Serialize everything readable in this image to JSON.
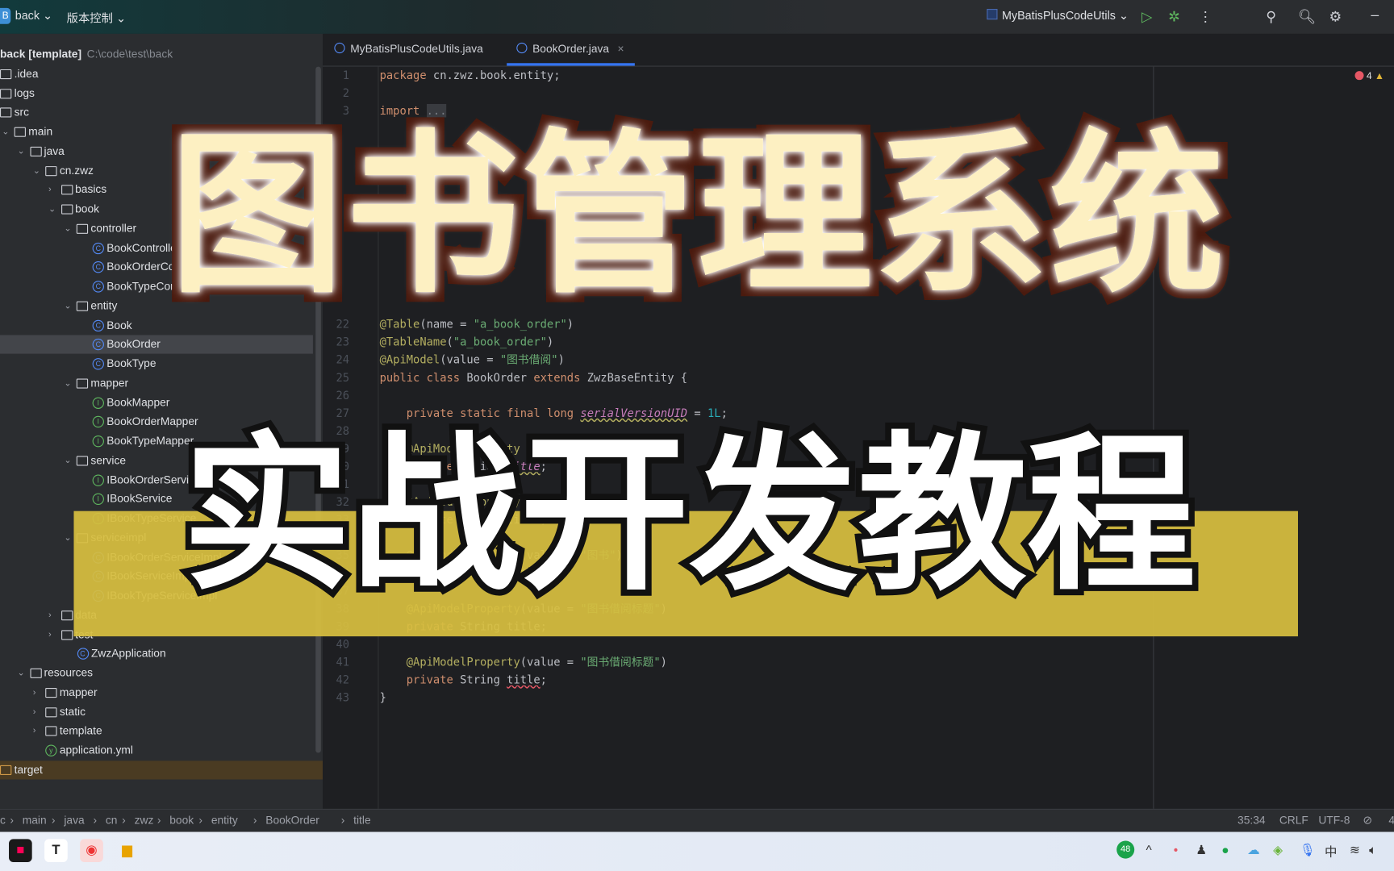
{
  "topbar": {
    "project_badge": "B",
    "project": "back",
    "vcs": "版本控制",
    "run_config": "MyBatisPlusCodeUtils",
    "icons": [
      "run-icon",
      "debug-icon",
      "more-icon",
      "add-user-icon",
      "search-icon",
      "gear-icon",
      "minimize-icon"
    ]
  },
  "sidebar": {
    "items": [
      {
        "label": "back [template]",
        "path": "C:\\code\\test\\back",
        "level": 0,
        "type": "root"
      },
      {
        "label": ".idea",
        "level": 0,
        "type": "folder"
      },
      {
        "label": "logs",
        "level": 0,
        "type": "folder"
      },
      {
        "label": "src",
        "level": 0,
        "type": "folder"
      },
      {
        "label": "main",
        "level": 1,
        "type": "folder",
        "chev": "open"
      },
      {
        "label": "java",
        "level": 2,
        "type": "folder",
        "chev": "open"
      },
      {
        "label": "cn.zwz",
        "level": 3,
        "type": "folder",
        "chev": "open"
      },
      {
        "label": "basics",
        "level": 4,
        "type": "package",
        "chev": "closed"
      },
      {
        "label": "book",
        "level": 4,
        "type": "package",
        "chev": "open"
      },
      {
        "label": "controller",
        "level": 5,
        "type": "package",
        "chev": "open"
      },
      {
        "label": "BookController",
        "level": 6,
        "type": "class"
      },
      {
        "label": "BookOrderController",
        "level": 6,
        "type": "class"
      },
      {
        "label": "BookTypeController",
        "level": 6,
        "type": "class"
      },
      {
        "label": "entity",
        "level": 5,
        "type": "package",
        "chev": "open"
      },
      {
        "label": "Book",
        "level": 6,
        "type": "class"
      },
      {
        "label": "BookOrder",
        "level": 6,
        "type": "class",
        "selected": true
      },
      {
        "label": "BookType",
        "level": 6,
        "type": "class"
      },
      {
        "label": "mapper",
        "level": 5,
        "type": "package",
        "chev": "open"
      },
      {
        "label": "BookMapper",
        "level": 6,
        "type": "interface"
      },
      {
        "label": "BookOrderMapper",
        "level": 6,
        "type": "interface"
      },
      {
        "label": "BookTypeMapper",
        "level": 6,
        "type": "interface"
      },
      {
        "label": "service",
        "level": 5,
        "type": "package",
        "chev": "open"
      },
      {
        "label": "IBookOrderService",
        "level": 6,
        "type": "interface"
      },
      {
        "label": "IBookService",
        "level": 6,
        "type": "interface"
      },
      {
        "label": "IBookTypeService",
        "level": 6,
        "type": "interface"
      },
      {
        "label": "serviceimpl",
        "level": 5,
        "type": "package",
        "chev": "open"
      },
      {
        "label": "IBookOrderServiceImpl",
        "level": 6,
        "type": "class"
      },
      {
        "label": "IBookServiceImpl",
        "level": 6,
        "type": "class"
      },
      {
        "label": "IBookTypeServiceImpl",
        "level": 6,
        "type": "class"
      },
      {
        "label": "data",
        "level": 4,
        "type": "package",
        "chev": "closed"
      },
      {
        "label": "test",
        "level": 4,
        "type": "package",
        "chev": "closed"
      },
      {
        "label": "ZwzApplication",
        "level": 4,
        "type": "class"
      },
      {
        "label": "resources",
        "level": 2,
        "type": "folder",
        "chev": "open"
      },
      {
        "label": "mapper",
        "level": 3,
        "type": "folder",
        "chev": "closed"
      },
      {
        "label": "static",
        "level": 3,
        "type": "folder",
        "chev": "closed"
      },
      {
        "label": "template",
        "level": 3,
        "type": "folder",
        "chev": "closed"
      },
      {
        "label": "application.yml",
        "level": 3,
        "type": "file"
      },
      {
        "label": "target",
        "level": 0,
        "type": "folder",
        "target": true
      }
    ]
  },
  "tabs": [
    {
      "label": "MyBatisPlusCodeUtils.java",
      "active": false
    },
    {
      "label": "BookOrder.java",
      "active": true,
      "close": "×"
    }
  ],
  "editor": {
    "problems": {
      "errors": "4"
    },
    "lines": [
      {
        "n": "1",
        "html": "<span class='kw'>package</span> cn.zwz.book.entity;"
      },
      {
        "n": "2",
        "html": ""
      },
      {
        "n": "3",
        "html": "<span class='kw'>import</span> <span style='background:#393b40;color:#7a7e85'>...</span>"
      },
      {
        "n": "",
        "html": ""
      },
      {
        "n": "",
        "html": ""
      },
      {
        "n": "",
        "html": ""
      },
      {
        "n": "",
        "html": ""
      },
      {
        "n": "",
        "html": ""
      },
      {
        "n": "",
        "html": ""
      },
      {
        "n": "",
        "html": ""
      },
      {
        "n": "",
        "html": ""
      },
      {
        "n": "",
        "html": ""
      },
      {
        "n": "",
        "html": ""
      },
      {
        "n": "",
        "html": ""
      },
      {
        "n": "22",
        "html": "<span class='an'>@Table</span>(name = <span class='st'>\"a_book_order\"</span>)"
      },
      {
        "n": "23",
        "html": "<span class='an'>@TableName</span>(<span class='st'>\"a_book_order\"</span>)"
      },
      {
        "n": "24",
        "html": "<span class='an'>@ApiModel</span>(value = <span class='st'>\"图书借阅\"</span>)"
      },
      {
        "n": "25",
        "html": "<span class='kw'>public class</span> BookOrder <span class='kw'>extends</span> ZwzBaseEntity {"
      },
      {
        "n": "26",
        "html": ""
      },
      {
        "n": "27",
        "html": "    <span class='kw'>private static final long</span> <span class='fld'>serialVersionUID</span> = <span class='num'>1L</span>;"
      },
      {
        "n": "28",
        "html": ""
      },
      {
        "n": "29",
        "html": "    <span class='an'>@ApiModelProperty</span>"
      },
      {
        "n": "30",
        "html": "    <span class='kw'>private</span> String <span class='fld'>title</span>;"
      },
      {
        "n": "31",
        "html": ""
      },
      {
        "n": "32",
        "html": "    <span class='an'>@ApiModelProperty</span>(value = <span class='st'>\"图书名称\"</span>)"
      },
      {
        "n": "33",
        "html": "    <span class='kw'>private</span> String title;"
      },
      {
        "n": "34",
        "html": ""
      },
      {
        "n": "35",
        "html": "    <span class='an'>@ApiModelProperty</span>(value = <span class='st'>\"图书\"</span>)"
      },
      {
        "n": "36",
        "html": "    <span class='kw'>private</span> String title;"
      },
      {
        "n": "37",
        "html": ""
      },
      {
        "n": "38",
        "html": "    <span class='an'>@ApiModelProperty</span>(value = <span class='st'>\"图书借阅标题\"</span>)"
      },
      {
        "n": "39",
        "html": "    <span class='kw'>private</span> String title;"
      },
      {
        "n": "40",
        "html": ""
      },
      {
        "n": "41",
        "html": "    <span class='an'>@ApiModelProperty</span>(value = <span class='st'>\"图书借阅标题\"</span>)"
      },
      {
        "n": "42",
        "html": "    <span class='kw'>private</span> String <span class='fld' style='color:#bcbec4;font-style:normal;text-decoration-color:#e55765'>title</span>;"
      },
      {
        "n": "43",
        "html": "}"
      }
    ]
  },
  "statusbar": {
    "breadcrumbs": [
      "c",
      "main",
      "java",
      "cn",
      "zwz",
      "book",
      "entity",
      "BookOrder",
      "title"
    ],
    "position": "35:34",
    "line_sep": "CRLF",
    "encoding": "UTF-8",
    "indent": "4"
  },
  "taskbar": {
    "apps": [
      "intellij-idea",
      "T",
      "chrome",
      "file-explorer"
    ],
    "tray_badge": "48",
    "ime": "中"
  },
  "overlay": {
    "title": "图书管理系统",
    "subtitle": "实战开发教程",
    "colors": {
      "title_fill": "#fdf0c2",
      "title_stroke": "#4a1a0e",
      "band": "#d7be40"
    }
  }
}
